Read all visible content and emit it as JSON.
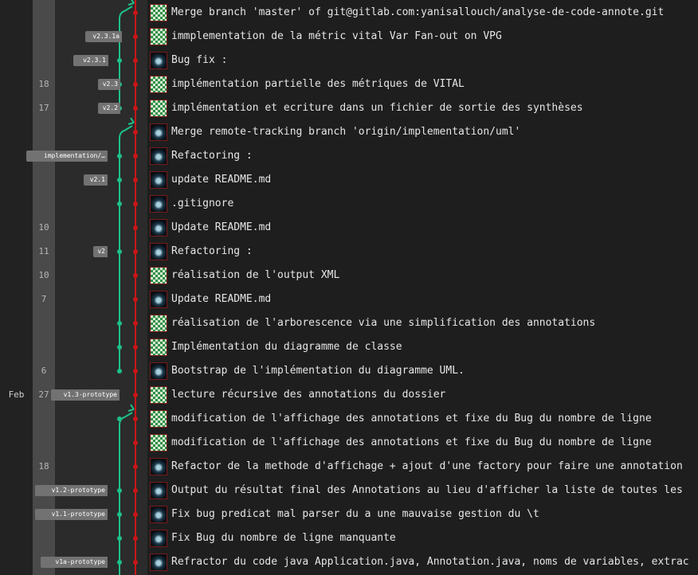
{
  "colors": {
    "master_branch": "#c81616",
    "feature_branch": "#1ec08a",
    "tag_background": "#727272"
  },
  "month_label": "Feb",
  "commits": [
    {
      "day": "",
      "tag": "",
      "avatar": "green-identicon-icon",
      "message": "Merge branch 'master' of git@gitlab.com:yanisallouch/analyse-de-code-annote.git"
    },
    {
      "day": "",
      "tag": "v2.3.1a",
      "avatar": "green-identicon-icon",
      "message": "immplementation de la métric vital Var Fan-out on VPG"
    },
    {
      "day": "",
      "tag": "v2.3.1",
      "avatar": "dark-avatar-icon",
      "message": "Bug fix :"
    },
    {
      "day": "18",
      "tag": "v2.3",
      "avatar": "green-identicon-icon",
      "message": "implémentation partielle des métriques de VITAL"
    },
    {
      "day": "17",
      "tag": "v2.2",
      "avatar": "green-identicon-icon",
      "message": "implémentation et ecriture dans un fichier de sortie des synthèses"
    },
    {
      "day": "",
      "tag": "",
      "avatar": "dark-avatar-icon",
      "message": "Merge remote-tracking branch 'origin/implementation/uml'"
    },
    {
      "day": "",
      "tag": "implementation/…",
      "avatar": "dark-avatar-icon",
      "message": "Refactoring :"
    },
    {
      "day": "",
      "tag": "v2.1",
      "avatar": "dark-avatar-icon",
      "message": "update README.md"
    },
    {
      "day": "",
      "tag": "",
      "avatar": "dark-avatar-icon",
      "message": ".gitignore"
    },
    {
      "day": "10",
      "tag": "",
      "avatar": "dark-avatar-icon",
      "message": "Update README.md"
    },
    {
      "day": "11",
      "tag": "v2",
      "avatar": "dark-avatar-icon",
      "message": "Refactoring :"
    },
    {
      "day": "10",
      "tag": "",
      "avatar": "green-identicon-icon",
      "message": "réalisation de l'output XML"
    },
    {
      "day": "7",
      "tag": "",
      "avatar": "dark-avatar-icon",
      "message": "Update README.md"
    },
    {
      "day": "",
      "tag": "",
      "avatar": "green-identicon-icon",
      "message": "réalisation de l'arborescence via une simplification des annotations"
    },
    {
      "day": "",
      "tag": "",
      "avatar": "green-identicon-icon",
      "message": "Implémentation du diagramme de classe"
    },
    {
      "day": "6",
      "tag": "",
      "avatar": "dark-avatar-icon",
      "message": "Bootstrap de l'implémentation du diagramme UML."
    },
    {
      "day": "27",
      "tag": "v1.3-prototype",
      "avatar": "green-identicon-icon",
      "message": "lecture récursive des annotations du dossier"
    },
    {
      "day": "",
      "tag": "",
      "avatar": "green-identicon-icon",
      "message": "modification de l'affichage des annotations et fixe du Bug du nombre de ligne"
    },
    {
      "day": "",
      "tag": "",
      "avatar": "green-identicon-icon",
      "message": "modification de l'affichage des annotations et fixe du Bug du nombre de ligne"
    },
    {
      "day": "18",
      "tag": "",
      "avatar": "dark-avatar-icon",
      "message": "Refactor de la methode d'affichage + ajout d'une factory pour faire une annotation"
    },
    {
      "day": "",
      "tag": "v1.2-prototype",
      "avatar": "dark-avatar-icon",
      "message": "Output du résultat final des Annotations au lieu d'afficher la liste de toutes les"
    },
    {
      "day": "",
      "tag": "v1.1-prototype",
      "avatar": "dark-avatar-icon",
      "message": "Fix bug predicat mal parser du a une mauvaise gestion du \\t"
    },
    {
      "day": "",
      "tag": "",
      "avatar": "dark-avatar-icon",
      "message": "Fix Bug du nombre de ligne manquante"
    },
    {
      "day": "",
      "tag": "v1a-prototype",
      "avatar": "dark-avatar-icon",
      "message": "Refractor du code java Application.java, Annotation.java, noms de variables, extrac"
    }
  ]
}
